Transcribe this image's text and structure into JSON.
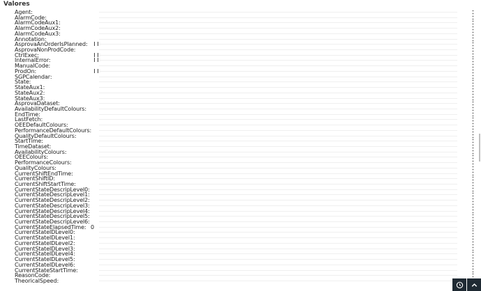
{
  "panel": {
    "title": "Valores"
  },
  "rows": [
    {
      "label": "Agent:",
      "value": "",
      "bars": false
    },
    {
      "label": "AlarmCode:",
      "value": "",
      "bars": false
    },
    {
      "label": "AlarmCodeAux1:",
      "value": "",
      "bars": false
    },
    {
      "label": "AlarmCodeAux2:",
      "value": "",
      "bars": false
    },
    {
      "label": "AlarmCodeAux3:",
      "value": "",
      "bars": false
    },
    {
      "label": "Annotation:",
      "value": "",
      "bars": false
    },
    {
      "label": "AsprovaAnOrderIsPlanned:",
      "value": "",
      "bars": true
    },
    {
      "label": "AsprovaNonProdCode:",
      "value": "",
      "bars": false
    },
    {
      "label": "CtrlExec:",
      "value": "",
      "bars": true
    },
    {
      "label": "InternalError:",
      "value": "",
      "bars": true
    },
    {
      "label": "ManualCode:",
      "value": "",
      "bars": false
    },
    {
      "label": "ProdOn:",
      "value": "",
      "bars": true
    },
    {
      "label": "SGPCalendar:",
      "value": "",
      "bars": false
    },
    {
      "label": "State:",
      "value": "",
      "bars": false
    },
    {
      "label": "StateAux1:",
      "value": "",
      "bars": false
    },
    {
      "label": "StateAux2:",
      "value": "",
      "bars": false
    },
    {
      "label": "StateAux3:",
      "value": "",
      "bars": false
    },
    {
      "label": "AsprovaDataset:",
      "value": "",
      "bars": false
    },
    {
      "label": "AvailabilityDefaultColours:",
      "value": "",
      "bars": false
    },
    {
      "label": "EndTime:",
      "value": "",
      "bars": false
    },
    {
      "label": "LastFetch:",
      "value": "",
      "bars": false
    },
    {
      "label": "OEEDefaultColours:",
      "value": "",
      "bars": false
    },
    {
      "label": "PerformanceDefaultColours:",
      "value": "",
      "bars": false
    },
    {
      "label": "QualityDefaultColours:",
      "value": "",
      "bars": false
    },
    {
      "label": "StartTime:",
      "value": "",
      "bars": false
    },
    {
      "label": "TimeDataset:",
      "value": "",
      "bars": false
    },
    {
      "label": "AvailabilityColours:",
      "value": "",
      "bars": false
    },
    {
      "label": "OEEColours:",
      "value": "",
      "bars": false
    },
    {
      "label": "PerformanceColours:",
      "value": "",
      "bars": false
    },
    {
      "label": "QualityColours:",
      "value": "",
      "bars": false
    },
    {
      "label": "CurrentShiftEndTime:",
      "value": "",
      "bars": false
    },
    {
      "label": "CurrentShiftID:",
      "value": "",
      "bars": false
    },
    {
      "label": "CurrentShiftStartTime:",
      "value": "",
      "bars": false
    },
    {
      "label": "CurrentStateDescripLevel0:",
      "value": "",
      "bars": false
    },
    {
      "label": "CurrentStateDescripLevel1:",
      "value": "",
      "bars": false
    },
    {
      "label": "CurrentStateDescripLevel2:",
      "value": "",
      "bars": false
    },
    {
      "label": "CurrentStateDescripLevel3:",
      "value": "",
      "bars": false
    },
    {
      "label": "CurrentStateDescripLevel4:",
      "value": "",
      "bars": false
    },
    {
      "label": "CurrentStateDescripLevel5:",
      "value": "",
      "bars": false
    },
    {
      "label": "CurrentStateDescripLevel6:",
      "value": "",
      "bars": false
    },
    {
      "label": "CurrentStateElapsedTime:",
      "value": "0",
      "bars": false
    },
    {
      "label": "CurrentStateIDLevel0:",
      "value": "",
      "bars": false
    },
    {
      "label": "CurrentStateIDLevel1:",
      "value": "",
      "bars": false
    },
    {
      "label": "CurrentStateIDLevel2:",
      "value": "",
      "bars": false
    },
    {
      "label": "CurrentStateIDLevel3:",
      "value": "",
      "bars": false
    },
    {
      "label": "CurrentStateIDLevel4:",
      "value": "",
      "bars": false
    },
    {
      "label": "CurrentStateIDLevel5:",
      "value": "",
      "bars": false
    },
    {
      "label": "CurrentStateIDLevel6:",
      "value": "",
      "bars": false
    },
    {
      "label": "CurrentStateStartTime:",
      "value": "",
      "bars": false
    },
    {
      "label": "ReasonCode:",
      "value": "",
      "bars": false
    },
    {
      "label": "TheoricalSpeed:",
      "value": "",
      "bars": false
    }
  ],
  "icons": {
    "row_menu": "vertical-dots-icon",
    "history": "clock-icon",
    "collapse": "chevron-up-icon"
  },
  "colors": {
    "bottom_button_bg": "#1f2a33",
    "separator": "#efefef"
  }
}
